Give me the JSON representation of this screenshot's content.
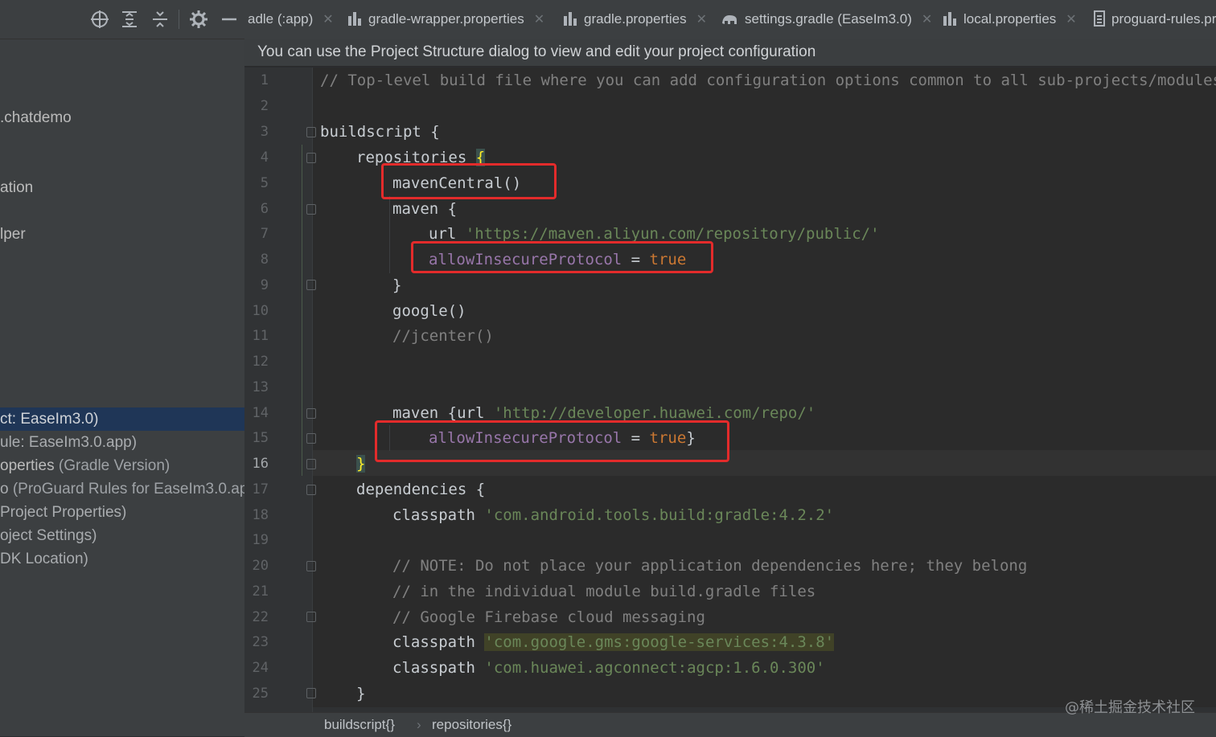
{
  "sidebar": {
    "toolbar": {
      "locate_icon": "crosshair-icon",
      "expand_icon": "expand-all-icon",
      "collapse_icon": "collapse-all-icon",
      "settings_icon": "gear-icon",
      "hide_icon": "minimize-icon"
    },
    "tree_items": [
      {
        "label": ".chatdemo",
        "extra": ""
      },
      {
        "label": "ation",
        "extra": ""
      },
      {
        "label": "lper",
        "extra": ""
      },
      {
        "label": "ct: EaseIm3.0)",
        "extra": "",
        "selected": true
      },
      {
        "label": "ule: EaseIm3.0.app)",
        "extra": ""
      },
      {
        "label": "operties",
        "extra": " (Gradle Version)"
      },
      {
        "label": "o",
        "extra": " (ProGuard Rules for EaseIm3.0.ap"
      },
      {
        "label": " Project Properties)",
        "extra": ""
      },
      {
        "label": "oject Settings)",
        "extra": ""
      },
      {
        "label": "DK Location)",
        "extra": ""
      }
    ]
  },
  "tabs": [
    {
      "label": "adle (:app)",
      "icon": "gradle-file-icon"
    },
    {
      "label": "gradle-wrapper.properties",
      "icon": "properties-file-icon"
    },
    {
      "label": "gradle.properties",
      "icon": "properties-file-icon"
    },
    {
      "label": "settings.gradle (EaseIm3.0)",
      "icon": "gradle-elephant-icon"
    },
    {
      "label": "local.properties",
      "icon": "properties-file-icon"
    },
    {
      "label": "proguard-rules.pr",
      "icon": "text-file-icon"
    }
  ],
  "banner": {
    "message": "You can use the Project Structure dialog to view and edit your project configuration"
  },
  "editor": {
    "line_numbers": [
      "1",
      "2",
      "3",
      "4",
      "5",
      "6",
      "7",
      "8",
      "9",
      "10",
      "11",
      "12",
      "13",
      "14",
      "15",
      "16",
      "17",
      "18",
      "19",
      "20",
      "21",
      "22",
      "23",
      "24",
      "25"
    ],
    "current_line": "16",
    "lines": {
      "l1": "// Top-level build file where you can add configuration options common to all sub-projects/modules.",
      "l3_kw": "buildscript",
      "l3_brace": " {",
      "l4_kw": "repositories",
      "l4_brace": "{",
      "l5": "mavenCentral()",
      "l6_kw": "maven",
      "l6_brace": " {",
      "l7_kw": "url",
      "l7_str": "'https://maven.aliyun.com/repository/public/'",
      "l8_prop": "allowInsecureProtocol",
      "l8_eq": " = ",
      "l8_val": "true",
      "l9": "}",
      "l10": "google()",
      "l11": "//jcenter()",
      "l14_kw": "maven",
      "l14_mid": " {url ",
      "l14_str": "'http://developer.huawei.com/repo/'",
      "l15_prop": "allowInsecureProtocol",
      "l15_eq": " = ",
      "l15_val": "true",
      "l15_close": "}",
      "l16": "}",
      "l17_kw": "dependencies",
      "l17_brace": " {",
      "l18_kw": "classpath",
      "l18_str": "'com.android.tools.build:gradle:4.2.2'",
      "l20": "// NOTE: Do not place your application dependencies here; they belong",
      "l21": "// in the individual module build.gradle files",
      "l22": "// Google Firebase cloud messaging",
      "l23_kw": "classpath",
      "l23_str": "'com.google.gms:google-services:4.3.8'",
      "l24_kw": "classpath",
      "l24_str": "'com.huawei.agconnect:agcp:1.6.0.300'",
      "l25": "}"
    }
  },
  "statusbar": {
    "breadcrumbs": [
      "buildscript{}",
      "repositories{}"
    ],
    "separator": "›"
  },
  "watermark": "@稀土掘金技术社区",
  "colors": {
    "highlight_box": "#e32b2b",
    "selection": "#1f3657",
    "keyword": "#cc7832",
    "string": "#6a8759",
    "property": "#9876aa",
    "comment": "#808080"
  }
}
